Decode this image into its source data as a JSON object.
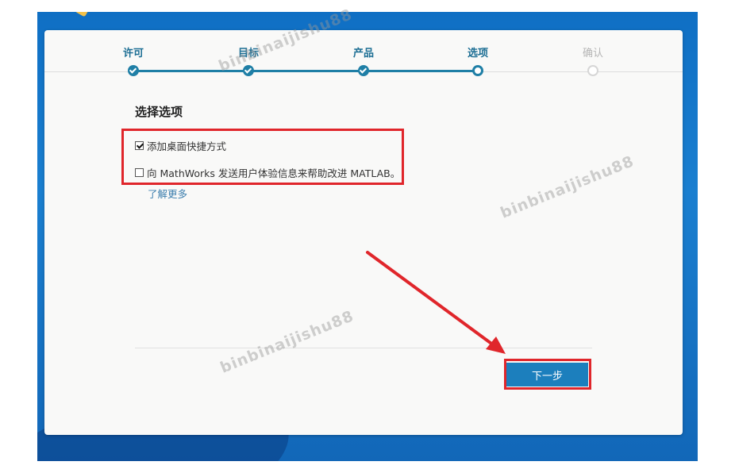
{
  "steps": [
    {
      "label": "许可",
      "state": "done"
    },
    {
      "label": "目标",
      "state": "done"
    },
    {
      "label": "产品",
      "state": "done"
    },
    {
      "label": "选项",
      "state": "current"
    },
    {
      "label": "确认",
      "state": "inactive"
    }
  ],
  "section_title": "选择选项",
  "options": [
    {
      "label": "添加桌面快捷方式",
      "checked": true
    },
    {
      "label": "向 MathWorks 发送用户体验信息来帮助改进 MATLAB。",
      "checked": false
    }
  ],
  "learn_more": "了解更多",
  "next_button": "下一步",
  "watermark": "binbinaijishu88",
  "colors": {
    "accent": "#1f7fa6",
    "button": "#1c7fbd",
    "annotation": "#e0262b",
    "link": "#3d7fae"
  }
}
